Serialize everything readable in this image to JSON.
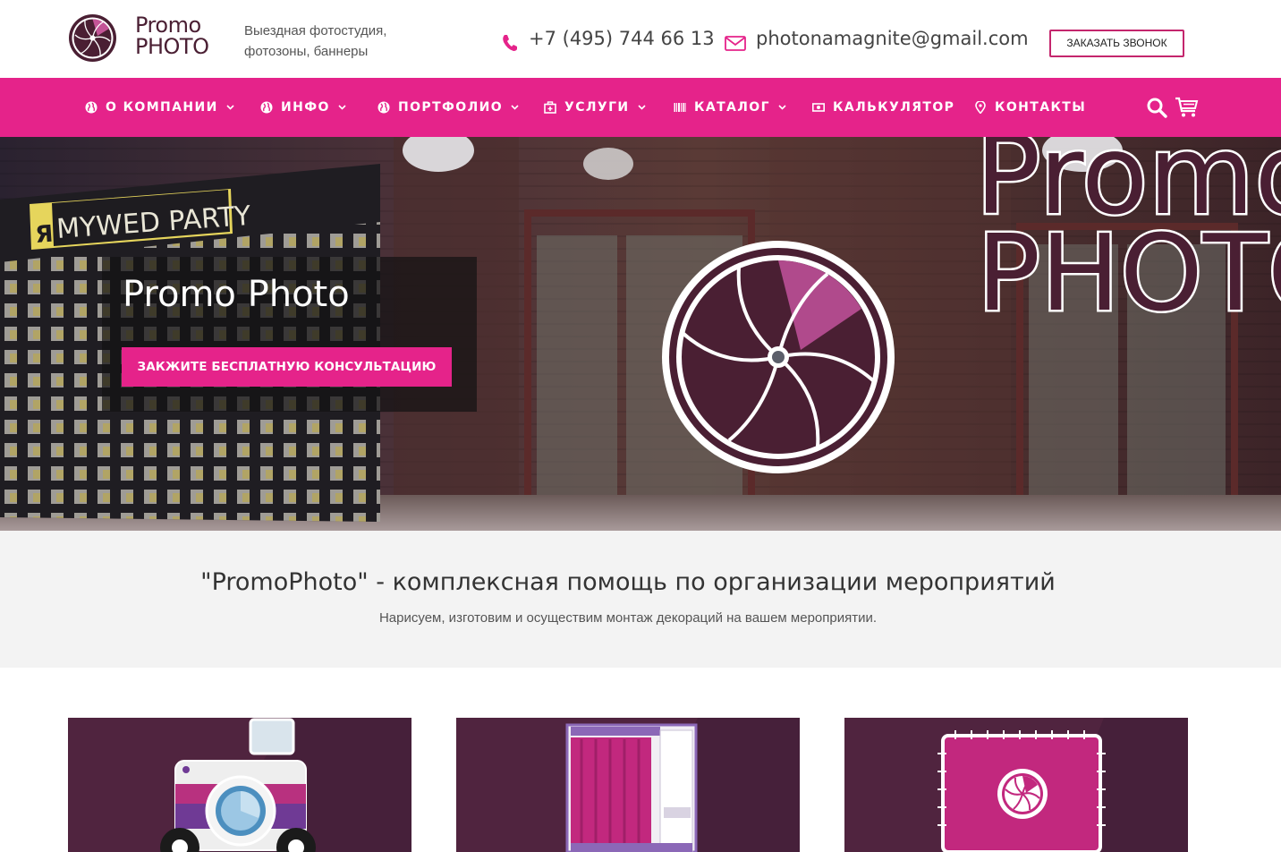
{
  "header": {
    "brand_line1": "Promo",
    "brand_line2": "PHOTO",
    "tagline_line1": "Выездная фотостудия,",
    "tagline_line2": "фотозоны, баннеры",
    "phone": "+7 (495) 744 66 13",
    "email": "photonamagnite@gmail.com",
    "call_button": "ЗАКАЗАТЬ ЗВОНОК"
  },
  "nav": {
    "items": [
      {
        "label": "О КОМПАНИИ",
        "icon": "globe-icon",
        "dropdown": true
      },
      {
        "label": "ИНФО",
        "icon": "globe-icon",
        "dropdown": true
      },
      {
        "label": "ПОРТФОЛИО",
        "icon": "globe-icon",
        "dropdown": true
      },
      {
        "label": "УСЛУГИ",
        "icon": "medkit-icon",
        "dropdown": true
      },
      {
        "label": "КАТАЛОГ",
        "icon": "barcode-icon",
        "dropdown": true
      },
      {
        "label": "КАЛЬКУЛЯТОР",
        "icon": "money-icon",
        "dropdown": false
      },
      {
        "label": "КОНТАКТЫ",
        "icon": "map-pin-icon",
        "dropdown": false
      }
    ],
    "search_icon": "search-icon",
    "cart_icon": "cart-icon"
  },
  "hero": {
    "title": "Promo Photo",
    "button": "ЗАКЖИТЕ БЕСПЛАТНУЮ КОНСУЛЬТАЦИЮ",
    "banner_text": "ЯMYWED PARTY",
    "sign_line1": "Promo",
    "sign_line2": "PHOTO"
  },
  "intro": {
    "title": "\"PromoPhoto\" - комплексная помощь по организации мероприятий",
    "subtitle": "Нарисуем, изготовим и осуществим монтаж декораций на вашем мероприятии."
  },
  "cards": [
    {
      "icon": "camera-robot-icon"
    },
    {
      "icon": "photo-booth-icon"
    },
    {
      "icon": "banner-icon"
    }
  ],
  "colors": {
    "accent": "#e5238a",
    "brand_dark": "#4a1f33",
    "card_bg": "#50243f",
    "intro_bg": "#f3f3f3"
  }
}
